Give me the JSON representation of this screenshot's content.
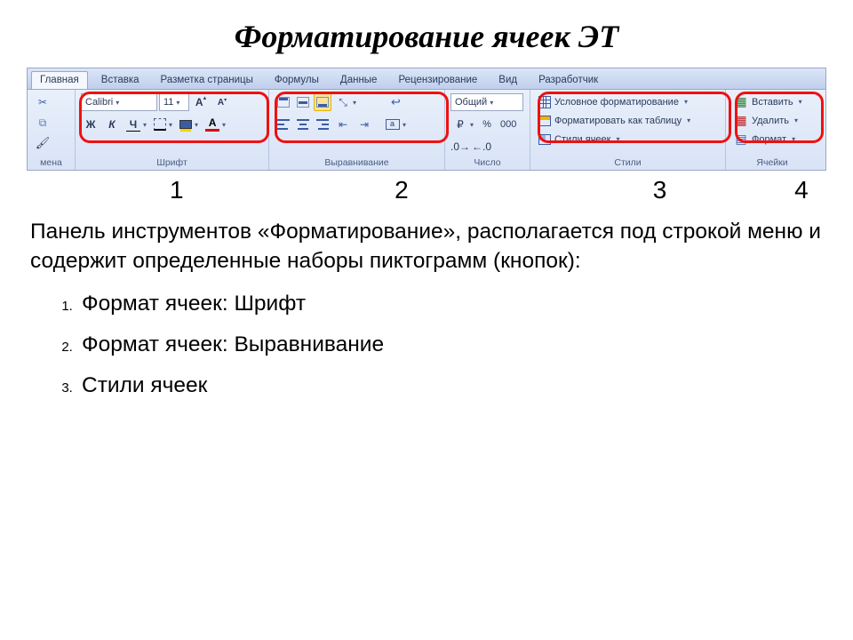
{
  "title": "Форматирование ячеек ЭТ",
  "tabs": [
    "Главная",
    "Вставка",
    "Разметка страницы",
    "Формулы",
    "Данные",
    "Рецензирование",
    "Вид",
    "Разработчик"
  ],
  "clipboard": {
    "label": "мена"
  },
  "font": {
    "label": "Шрифт",
    "name": "Calibri",
    "size": "11"
  },
  "align": {
    "label": "Выравнивание"
  },
  "number": {
    "label": "Число",
    "format": "Общий",
    "percent": "%",
    "thousands": "000"
  },
  "styles": {
    "label": "Стили",
    "cond": "Условное форматирование",
    "table": "Форматировать как таблицу",
    "cell": "Стили ячеек"
  },
  "cells": {
    "label": "Ячейки",
    "insert": "Вставить",
    "delete": "Удалить",
    "format": "Формат"
  },
  "nums": {
    "n1": "1",
    "n2": "2",
    "n3": "3",
    "n4": "4"
  },
  "text": {
    "para": "Панель инструментов «Форматирование», располагается под строкой меню и содержит определенные наборы пиктограмм (кнопок):",
    "i1": "Формат ячеек: Шрифт",
    "i2": "Формат ячеек: Выравнивание",
    "i3": "Стили ячеек"
  }
}
